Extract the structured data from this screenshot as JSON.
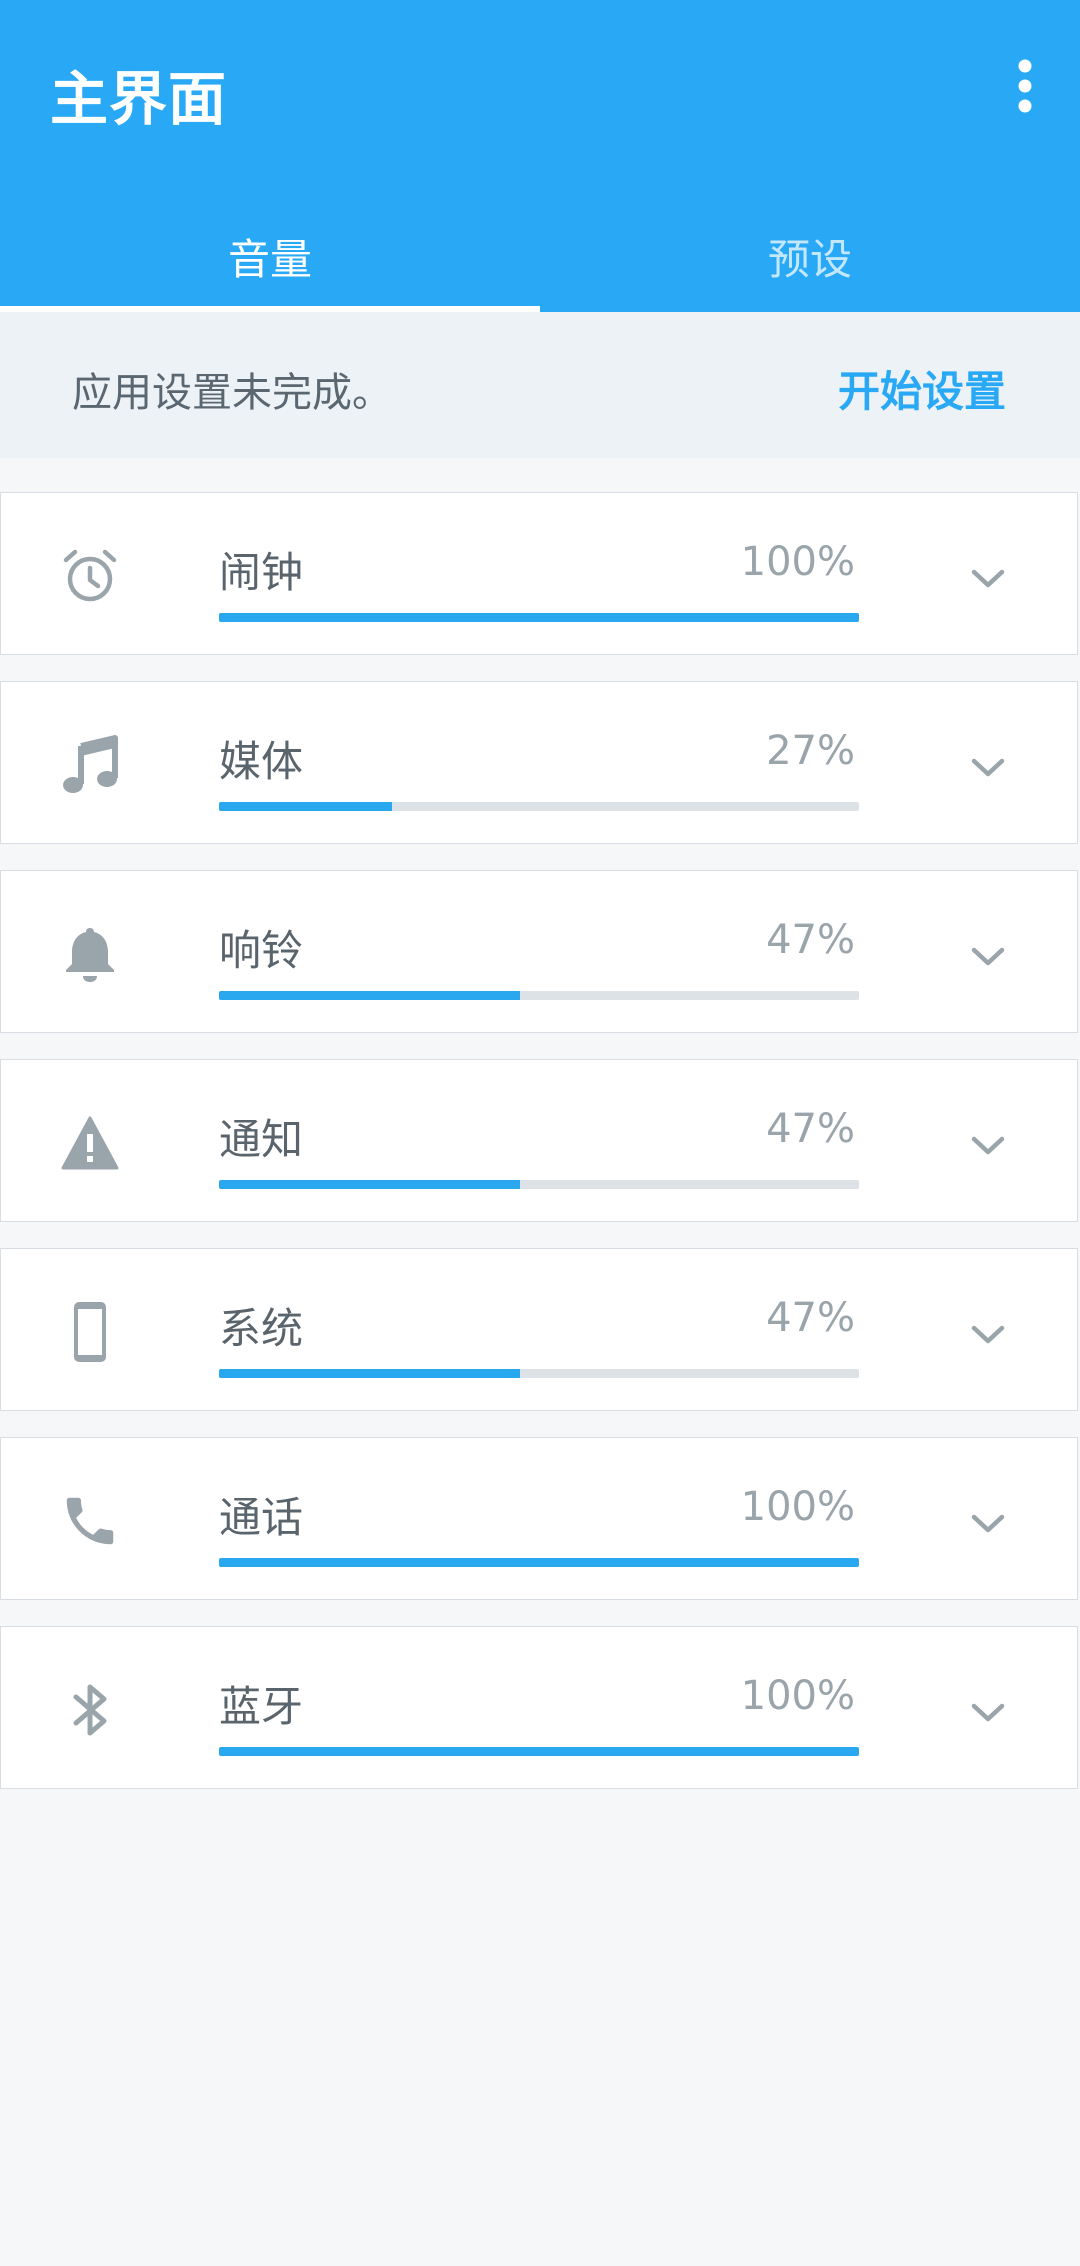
{
  "header": {
    "title": "主界面",
    "menu_icon": "more-vert-icon"
  },
  "tabs": [
    {
      "label": "音量",
      "active": true
    },
    {
      "label": "预设",
      "active": false
    }
  ],
  "banner": {
    "message": "应用设置未完成。",
    "action": "开始设置"
  },
  "volumes": [
    {
      "label": "闹钟",
      "percent_text": "100%",
      "value": 100,
      "icon": "alarm-clock-icon"
    },
    {
      "label": "媒体",
      "percent_text": "27%",
      "value": 27,
      "icon": "music-note-icon"
    },
    {
      "label": "响铃",
      "percent_text": "47%",
      "value": 47,
      "icon": "bell-icon"
    },
    {
      "label": "通知",
      "percent_text": "47%",
      "value": 47,
      "icon": "warning-icon"
    },
    {
      "label": "系统",
      "percent_text": "47%",
      "value": 47,
      "icon": "phone-device-icon"
    },
    {
      "label": "通话",
      "percent_text": "100%",
      "value": 100,
      "icon": "phone-call-icon"
    },
    {
      "label": "蓝牙",
      "percent_text": "100%",
      "value": 100,
      "icon": "bluetooth-icon"
    }
  ],
  "colors": {
    "primary": "#29a9f5",
    "track": "#dde2e6",
    "icon": "#9aa4ab"
  }
}
